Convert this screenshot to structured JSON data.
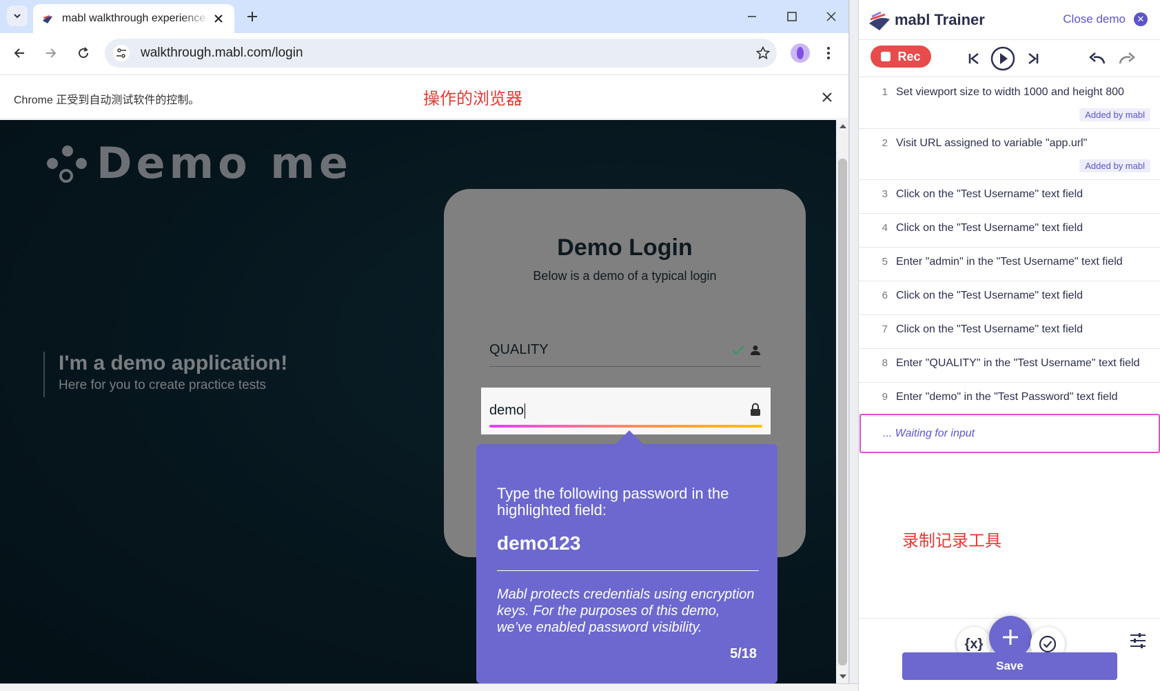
{
  "browser": {
    "tab_title": "mabl walkthrough experience",
    "url": "walkthrough.mabl.com/login",
    "automation_notice": "Chrome 正受到自动测试软件的控制。",
    "annotation_browser": "操作的浏览器"
  },
  "page": {
    "logo_text": "Demo me",
    "hero_title": "I'm a demo application!",
    "hero_subtitle": "Here for you to create practice tests",
    "login_title": "Demo Login",
    "login_subtitle": "Below is a demo of a typical login",
    "username_value": "QUALITY",
    "password_value": "demo"
  },
  "tooltip": {
    "instruction": "Type the following password in the highlighted field:",
    "password": "demo123",
    "note": "Mabl protects credentials using encryption keys. For the purposes of this demo, we’ve enabled password visibility.",
    "step": "5/18"
  },
  "trainer": {
    "title": "mabl Trainer",
    "close_label": "Close demo",
    "rec_label": "Rec",
    "steps": [
      {
        "num": "1",
        "text": "Set viewport size to width 1000 and height 800",
        "badge": "Added by mabl"
      },
      {
        "num": "2",
        "text": "Visit URL assigned to variable \"app.url\"",
        "badge": "Added by mabl"
      },
      {
        "num": "3",
        "text": "Click on the \"Test Username\" text field"
      },
      {
        "num": "4",
        "text": "Click on the \"Test Username\" text field"
      },
      {
        "num": "5",
        "text": "Enter \"admin\" in the \"Test Username\" text field"
      },
      {
        "num": "6",
        "text": "Click on the \"Test Username\" text field"
      },
      {
        "num": "7",
        "text": "Click on the \"Test Username\" text field"
      },
      {
        "num": "8",
        "text": "Enter \"QUALITY\" in the \"Test Username\" text field"
      },
      {
        "num": "9",
        "text": "Enter \"demo\" in the \"Test Password\" text field"
      }
    ],
    "waiting_text": "... Waiting for input",
    "annotation_trainer": "录制记录工具",
    "variables_label": "{x}",
    "save_label": "Save"
  },
  "colors": {
    "accent": "#6c68cf",
    "rec": "#e84b4b",
    "annotation": "#e53935",
    "page_bg": "#06151c"
  },
  "icons": [
    "tab-list-icon",
    "favicon-icon",
    "close-icon",
    "plus-icon",
    "minimize-icon",
    "maximize-icon",
    "back-icon",
    "forward-icon",
    "reload-icon",
    "site-info-icon",
    "star-icon",
    "profile-icon",
    "menu-icon",
    "check-icon",
    "person-icon",
    "lock-icon",
    "skip-back-icon",
    "play-icon",
    "skip-forward-icon",
    "undo-icon",
    "redo-icon",
    "settings-sliders-icon"
  ]
}
